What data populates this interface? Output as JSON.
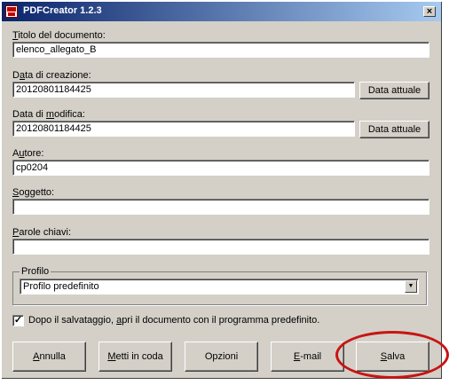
{
  "window": {
    "title": "PDFCreator 1.2.3",
    "close_glyph": "×"
  },
  "fields": {
    "title_label_hot": "T",
    "title_label_rest": "itolo del documento:",
    "title_value": "elenco_allegato_B",
    "created_label_pre": "D",
    "created_label_hot": "a",
    "created_label_rest": "ta di creazione:",
    "created_value": "20120801184425",
    "modified_label_pre": "Data di ",
    "modified_label_hot": "m",
    "modified_label_rest": "odifica:",
    "modified_value": "20120801184425",
    "author_label_pre": "A",
    "author_label_hot": "u",
    "author_label_rest": "tore:",
    "author_value": "cp0204",
    "subject_label_hot": "S",
    "subject_label_rest": "oggetto:",
    "subject_value": "",
    "keywords_label_hot": "P",
    "keywords_label_rest": "arole chiavi:",
    "keywords_value": ""
  },
  "buttons": {
    "current_date": "Data attuale",
    "cancel_hot": "A",
    "cancel_rest": "nnulla",
    "queue_hot": "M",
    "queue_rest": "etti in coda",
    "options": "Opzioni",
    "email_hot": "E",
    "email_rest": "-mail",
    "save_hot": "S",
    "save_rest": "alva"
  },
  "profile": {
    "legend": "Profilo",
    "selected": "Profilo predefinito",
    "arrow_glyph": "▼"
  },
  "open_after_save": {
    "checked": true,
    "check_glyph": "✓",
    "label_pre": "Dopo il salvataggio, ",
    "label_hot": "a",
    "label_rest": "pri il documento con il programma predefinito."
  },
  "highlight": {
    "color": "#c81414",
    "target": "save-button"
  }
}
